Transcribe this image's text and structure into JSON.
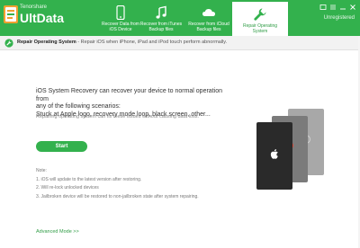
{
  "app": {
    "brand_top": "Tenorshare",
    "brand_name": "UltData",
    "status": "Unregistered"
  },
  "tabs": [
    {
      "label_line1": "Recover Data from",
      "label_line2": "iOS Device",
      "icon": "phone-icon"
    },
    {
      "label_line1": "Recover from iTunes",
      "label_line2": "Backup files",
      "icon": "music-note-icon"
    },
    {
      "label_line1": "Recover from iCloud",
      "label_line2": "Backup files",
      "icon": "cloud-icon"
    },
    {
      "label_line1": "Repair Operating",
      "label_line2": "System",
      "icon": "wrench-icon",
      "active": true
    }
  ],
  "subbar": {
    "title": "Repair Operating System",
    "description": " - Repair iOS when iPhone, iPad and iPod touch perform abnormally."
  },
  "main": {
    "desc_line1": "iOS System Recovery can recover your device to normal operation from",
    "desc_line2": "any of the following scenarios:",
    "desc_line3": "Stuck at Apple logo, recovery mode loop, black screen, other...",
    "sub": "Repairing operating system can fix these issues without causing data loss.",
    "start_label": "Start"
  },
  "notes": {
    "title": "Note:",
    "items": [
      "1. iOS will update to the latest version after restoring.",
      "2. Will re-lock unlocked devices",
      "3. Jailbroken device will be restored to non-jailbroken state after system repairing."
    ]
  },
  "advanced_label": "Advanced Mode >>",
  "colors": {
    "brand_green": "#33b14d",
    "link_green": "#2f9c45"
  }
}
